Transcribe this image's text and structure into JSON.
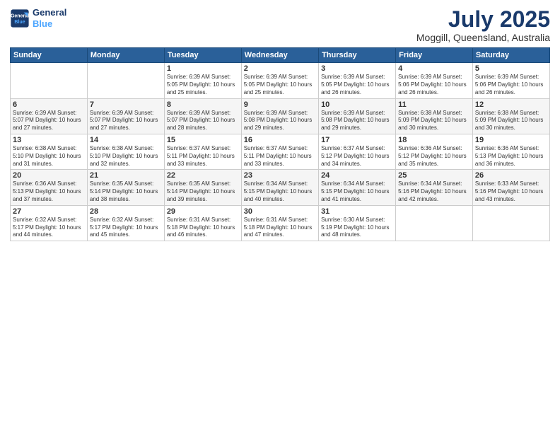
{
  "header": {
    "logo_line1": "General",
    "logo_line2": "Blue",
    "title": "July 2025",
    "subtitle": "Moggill, Queensland, Australia"
  },
  "days_of_week": [
    "Sunday",
    "Monday",
    "Tuesday",
    "Wednesday",
    "Thursday",
    "Friday",
    "Saturday"
  ],
  "weeks": [
    [
      {
        "day": "",
        "info": ""
      },
      {
        "day": "",
        "info": ""
      },
      {
        "day": "1",
        "info": "Sunrise: 6:39 AM\nSunset: 5:05 PM\nDaylight: 10 hours\nand 25 minutes."
      },
      {
        "day": "2",
        "info": "Sunrise: 6:39 AM\nSunset: 5:05 PM\nDaylight: 10 hours\nand 25 minutes."
      },
      {
        "day": "3",
        "info": "Sunrise: 6:39 AM\nSunset: 5:05 PM\nDaylight: 10 hours\nand 26 minutes."
      },
      {
        "day": "4",
        "info": "Sunrise: 6:39 AM\nSunset: 5:06 PM\nDaylight: 10 hours\nand 26 minutes."
      },
      {
        "day": "5",
        "info": "Sunrise: 6:39 AM\nSunset: 5:06 PM\nDaylight: 10 hours\nand 26 minutes."
      }
    ],
    [
      {
        "day": "6",
        "info": "Sunrise: 6:39 AM\nSunset: 5:07 PM\nDaylight: 10 hours\nand 27 minutes."
      },
      {
        "day": "7",
        "info": "Sunrise: 6:39 AM\nSunset: 5:07 PM\nDaylight: 10 hours\nand 27 minutes."
      },
      {
        "day": "8",
        "info": "Sunrise: 6:39 AM\nSunset: 5:07 PM\nDaylight: 10 hours\nand 28 minutes."
      },
      {
        "day": "9",
        "info": "Sunrise: 6:39 AM\nSunset: 5:08 PM\nDaylight: 10 hours\nand 29 minutes."
      },
      {
        "day": "10",
        "info": "Sunrise: 6:39 AM\nSunset: 5:08 PM\nDaylight: 10 hours\nand 29 minutes."
      },
      {
        "day": "11",
        "info": "Sunrise: 6:38 AM\nSunset: 5:09 PM\nDaylight: 10 hours\nand 30 minutes."
      },
      {
        "day": "12",
        "info": "Sunrise: 6:38 AM\nSunset: 5:09 PM\nDaylight: 10 hours\nand 30 minutes."
      }
    ],
    [
      {
        "day": "13",
        "info": "Sunrise: 6:38 AM\nSunset: 5:10 PM\nDaylight: 10 hours\nand 31 minutes."
      },
      {
        "day": "14",
        "info": "Sunrise: 6:38 AM\nSunset: 5:10 PM\nDaylight: 10 hours\nand 32 minutes."
      },
      {
        "day": "15",
        "info": "Sunrise: 6:37 AM\nSunset: 5:11 PM\nDaylight: 10 hours\nand 33 minutes."
      },
      {
        "day": "16",
        "info": "Sunrise: 6:37 AM\nSunset: 5:11 PM\nDaylight: 10 hours\nand 33 minutes."
      },
      {
        "day": "17",
        "info": "Sunrise: 6:37 AM\nSunset: 5:12 PM\nDaylight: 10 hours\nand 34 minutes."
      },
      {
        "day": "18",
        "info": "Sunrise: 6:36 AM\nSunset: 5:12 PM\nDaylight: 10 hours\nand 35 minutes."
      },
      {
        "day": "19",
        "info": "Sunrise: 6:36 AM\nSunset: 5:13 PM\nDaylight: 10 hours\nand 36 minutes."
      }
    ],
    [
      {
        "day": "20",
        "info": "Sunrise: 6:36 AM\nSunset: 5:13 PM\nDaylight: 10 hours\nand 37 minutes."
      },
      {
        "day": "21",
        "info": "Sunrise: 6:35 AM\nSunset: 5:14 PM\nDaylight: 10 hours\nand 38 minutes."
      },
      {
        "day": "22",
        "info": "Sunrise: 6:35 AM\nSunset: 5:14 PM\nDaylight: 10 hours\nand 39 minutes."
      },
      {
        "day": "23",
        "info": "Sunrise: 6:34 AM\nSunset: 5:15 PM\nDaylight: 10 hours\nand 40 minutes."
      },
      {
        "day": "24",
        "info": "Sunrise: 6:34 AM\nSunset: 5:15 PM\nDaylight: 10 hours\nand 41 minutes."
      },
      {
        "day": "25",
        "info": "Sunrise: 6:34 AM\nSunset: 5:16 PM\nDaylight: 10 hours\nand 42 minutes."
      },
      {
        "day": "26",
        "info": "Sunrise: 6:33 AM\nSunset: 5:16 PM\nDaylight: 10 hours\nand 43 minutes."
      }
    ],
    [
      {
        "day": "27",
        "info": "Sunrise: 6:32 AM\nSunset: 5:17 PM\nDaylight: 10 hours\nand 44 minutes."
      },
      {
        "day": "28",
        "info": "Sunrise: 6:32 AM\nSunset: 5:17 PM\nDaylight: 10 hours\nand 45 minutes."
      },
      {
        "day": "29",
        "info": "Sunrise: 6:31 AM\nSunset: 5:18 PM\nDaylight: 10 hours\nand 46 minutes."
      },
      {
        "day": "30",
        "info": "Sunrise: 6:31 AM\nSunset: 5:18 PM\nDaylight: 10 hours\nand 47 minutes."
      },
      {
        "day": "31",
        "info": "Sunrise: 6:30 AM\nSunset: 5:19 PM\nDaylight: 10 hours\nand 48 minutes."
      },
      {
        "day": "",
        "info": ""
      },
      {
        "day": "",
        "info": ""
      }
    ]
  ]
}
